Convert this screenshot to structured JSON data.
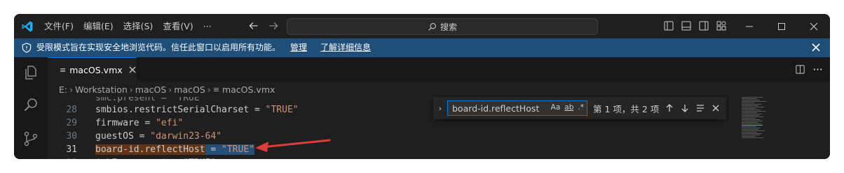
{
  "menu": [
    "文件(F)",
    "编辑(E)",
    "选择(S)",
    "查看(V)",
    "···"
  ],
  "search": {
    "placeholder": "搜索"
  },
  "banner": {
    "message": "受限模式旨在实现安全地浏览代码。信任此窗口以启用所有功能。",
    "manage": "管理",
    "learn_more": "了解详细信息"
  },
  "tab": {
    "label": "macOS.vmx"
  },
  "breadcrumb": [
    "E:",
    "Workstation",
    "macOS",
    "macOS",
    "macOS.vmx"
  ],
  "lines": [
    {
      "n": "28",
      "key": "smbios.restrictSerialCharset",
      "val": "\"TRUE\""
    },
    {
      "n": "29",
      "key": "firmware",
      "val": "\"efi\""
    },
    {
      "n": "30",
      "key": "guestOS",
      "val": "\"darwin23-64\""
    },
    {
      "n": "31",
      "key": "board-id.reflectHost",
      "val": "\"TRUE\""
    }
  ],
  "find": {
    "query": "board-id.reflectHost",
    "match_case": "Aa",
    "whole_word": "ab",
    "regex": ".*",
    "result": "第 1 项，共 2 项"
  },
  "colors": {
    "accent": "#0078d4",
    "banner": "#1f4e79",
    "string": "#ce9178",
    "arrow": "#e03b3b"
  }
}
